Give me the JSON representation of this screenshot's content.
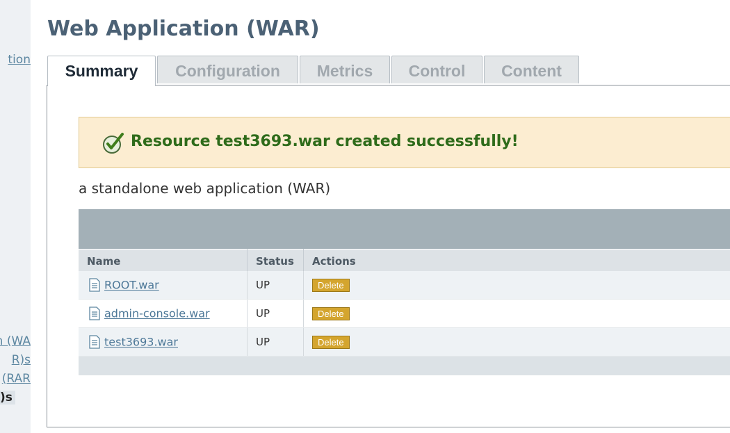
{
  "sidebar": {
    "items": [
      {
        "label": "tion"
      },
      {
        "label": "n (WA"
      },
      {
        "label": "R)s"
      },
      {
        "label": "(RAR"
      },
      {
        "label": ")s"
      }
    ]
  },
  "header": {
    "title": "Web Application (WAR)"
  },
  "tabs": [
    {
      "label": "Summary",
      "active": true
    },
    {
      "label": "Configuration"
    },
    {
      "label": "Metrics"
    },
    {
      "label": "Control"
    },
    {
      "label": "Content"
    }
  ],
  "message": {
    "text": "Resource test3693.war created successfully!",
    "icon": "check-icon"
  },
  "description": "a standalone web application (WAR)",
  "table": {
    "columns": [
      "Name",
      "Status",
      "Actions"
    ],
    "rows": [
      {
        "name": "ROOT.war",
        "status": "UP",
        "action": "Delete"
      },
      {
        "name": "admin-console.war",
        "status": "UP",
        "action": "Delete"
      },
      {
        "name": "test3693.war",
        "status": "UP",
        "action": "Delete"
      }
    ]
  },
  "colors": {
    "title": "#4b6175",
    "success_text": "#2e6b1a",
    "message_bg": "#fcedd1",
    "delete_button": "#d4a52e",
    "link": "#4d7898"
  }
}
